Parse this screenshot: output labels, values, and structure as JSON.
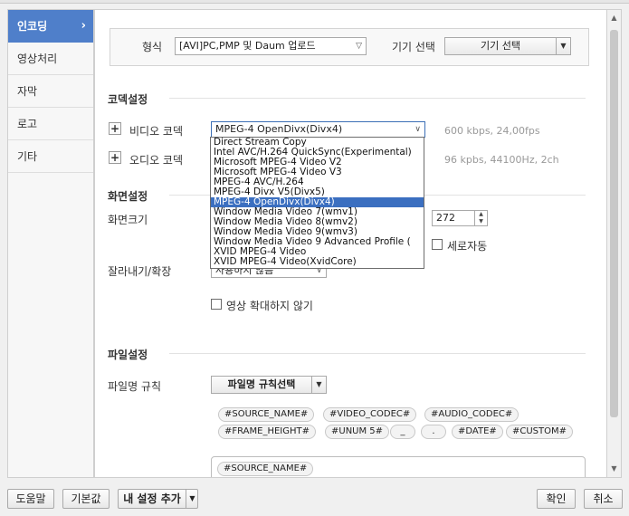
{
  "sidebar": {
    "items": [
      {
        "label": "인코딩",
        "active": true
      },
      {
        "label": "영상처리"
      },
      {
        "label": "자막"
      },
      {
        "label": "로고"
      },
      {
        "label": "기타"
      }
    ],
    "active_chevron": "›"
  },
  "format": {
    "label": "형식",
    "value": "[AVI]PC,PMP 및 Daum 업로드",
    "device_label": "기기 선택",
    "device_button": "기기 선택"
  },
  "codec": {
    "title": "코덱설정",
    "video_label": "비디오 코덱",
    "video_value": "MPEG-4 OpenDivx(Divx4)",
    "video_info": "600 kbps, 24,00fps",
    "audio_label": "오디오 코덱",
    "audio_info": "96 kpbs, 44100Hz, 2ch",
    "plus_icon": "+",
    "options": [
      "Direct Stream Copy",
      "Intel AVC/H.264 QuickSync(Experimental)",
      "Microsoft MPEG-4 Video V2",
      "Microsoft MPEG-4 Video V3",
      "MPEG-4 AVC/H.264",
      "MPEG-4 Divx V5(Divx5)",
      "MPEG-4 OpenDivx(Divx4)",
      "Window Media Video 7(wmv1)",
      "Window Media Video 8(wmv2)",
      "Window Media Video 9(wmv3)",
      "Window Media Video 9 Advanced Profile (",
      "XVID MPEG-4 Video",
      "XVID MPEG-4 Video(XvidCore)"
    ],
    "selected_index": 6
  },
  "screen": {
    "title": "화면설정",
    "size_label": "화면크기",
    "height_value": "272",
    "vertical_auto_label": "세로자동",
    "crop_label": "잘라내기/확장",
    "crop_value": "사용하지 않음",
    "no_enlarge_label": "영상 확대하지 않기"
  },
  "file": {
    "title": "파일설정",
    "name_rule_label": "파일명 규칙",
    "name_rule_button": "파일명 규칙선택",
    "tokens_row1": [
      "#SOURCE_NAME#",
      "#VIDEO_CODEC#",
      "#AUDIO_CODEC#"
    ],
    "tokens_row2": [
      "#FRAME_HEIGHT#",
      "#UNUM 5#",
      "_",
      ".",
      "#DATE#",
      "#CUSTOM#"
    ],
    "current_pattern": "#SOURCE_NAME#"
  },
  "footer": {
    "help": "도움말",
    "default": "기본값",
    "add_setting": "내 설정 추가",
    "ok": "확인",
    "cancel": "취소"
  },
  "icons": {
    "dropdown": "chevron-down-icon",
    "split_dropdown": "triangle-down-icon",
    "scroll_up": "triangle-up-icon",
    "scroll_down": "triangle-down-icon"
  }
}
